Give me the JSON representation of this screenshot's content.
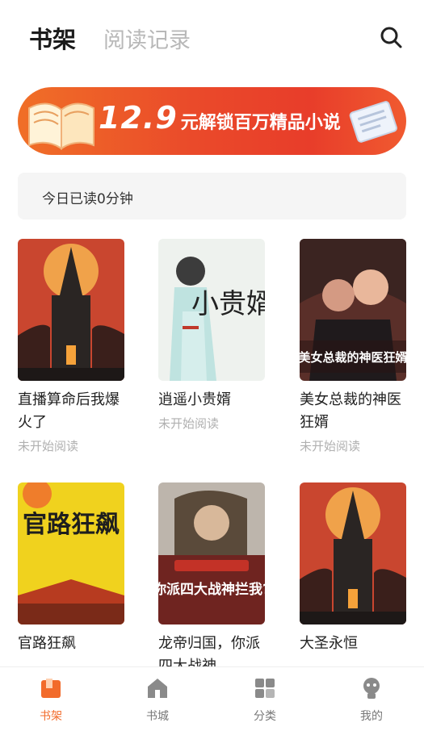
{
  "header": {
    "tab_bookshelf": "书架",
    "tab_history": "阅读记录",
    "search_icon": "search-icon"
  },
  "banner": {
    "price": "12.9",
    "text": "元解锁百万精品小说"
  },
  "reading": {
    "today": "今日已读0分钟"
  },
  "books": [
    {
      "title": "直播算命后我爆火了",
      "status": "未开始阅读"
    },
    {
      "title": "逍遥小贵婿",
      "status": "未开始阅读",
      "cover_text": "小贵婿"
    },
    {
      "title": "美女总裁的神医狂婿",
      "status": "未开始阅读",
      "cover_text": "美女总裁的神医狂婿"
    },
    {
      "title": "官路狂飙",
      "cover_text": "官路狂飙"
    },
    {
      "title": "龙帝归国，你派四大战神",
      "cover_text": "你派四大战神拦我?"
    },
    {
      "title": "大圣永恒"
    }
  ],
  "nav": {
    "items": [
      {
        "label": "书架",
        "icon": "bookshelf-icon",
        "active": true
      },
      {
        "label": "书城",
        "icon": "store-icon"
      },
      {
        "label": "分类",
        "icon": "category-icon"
      },
      {
        "label": "我的",
        "icon": "profile-icon"
      }
    ]
  },
  "colors": {
    "accent": "#f26b2b",
    "banner_start": "#f06f27",
    "banner_end": "#e83d2a"
  }
}
